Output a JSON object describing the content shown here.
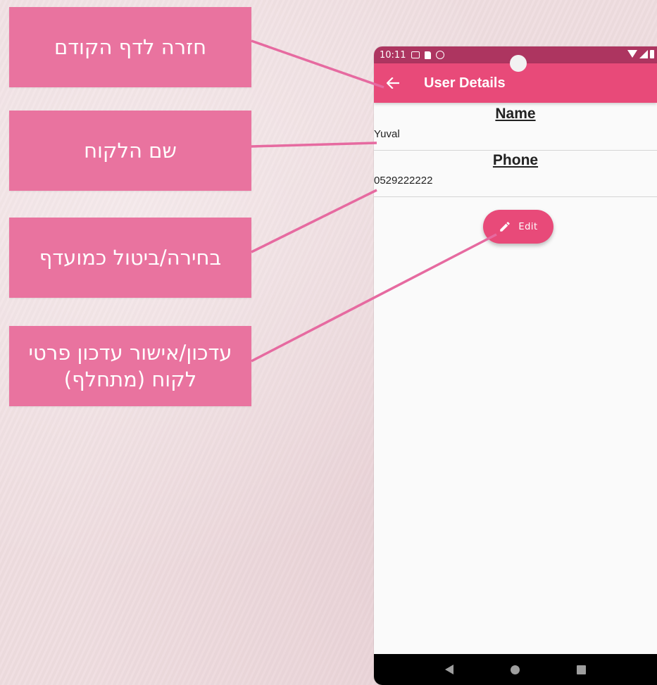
{
  "callouts": [
    {
      "text": "חזרה לדף הקודם"
    },
    {
      "text": "שם הלקוח"
    },
    {
      "text": "בחירה/ביטול כמועדף"
    },
    {
      "text": "עדכון/אישור עדכון פרטי לקוח (מתחלף)"
    }
  ],
  "status_bar": {
    "time": "10:11",
    "icons": [
      "gmail-icon",
      "sd-card-icon",
      "at-sign-icon",
      "wifi-icon",
      "signal-icon",
      "battery-icon"
    ]
  },
  "app_bar": {
    "title": "User Details",
    "back_icon": "arrow-left-icon"
  },
  "fields": {
    "name": {
      "label": "Name",
      "value": "Yuval"
    },
    "phone": {
      "label": "Phone",
      "value": "0529222222"
    }
  },
  "edit_button": {
    "label": "Edit",
    "icon": "pencil-icon"
  },
  "nav_bar": {
    "icons": [
      "nav-back-icon",
      "nav-home-icon",
      "nav-recents-icon"
    ]
  },
  "colors": {
    "callout": "#e9739f",
    "connector": "#e66aa0",
    "status_bar": "#ad3560",
    "app_bar": "#e84a79",
    "fab": "#e84a79"
  }
}
